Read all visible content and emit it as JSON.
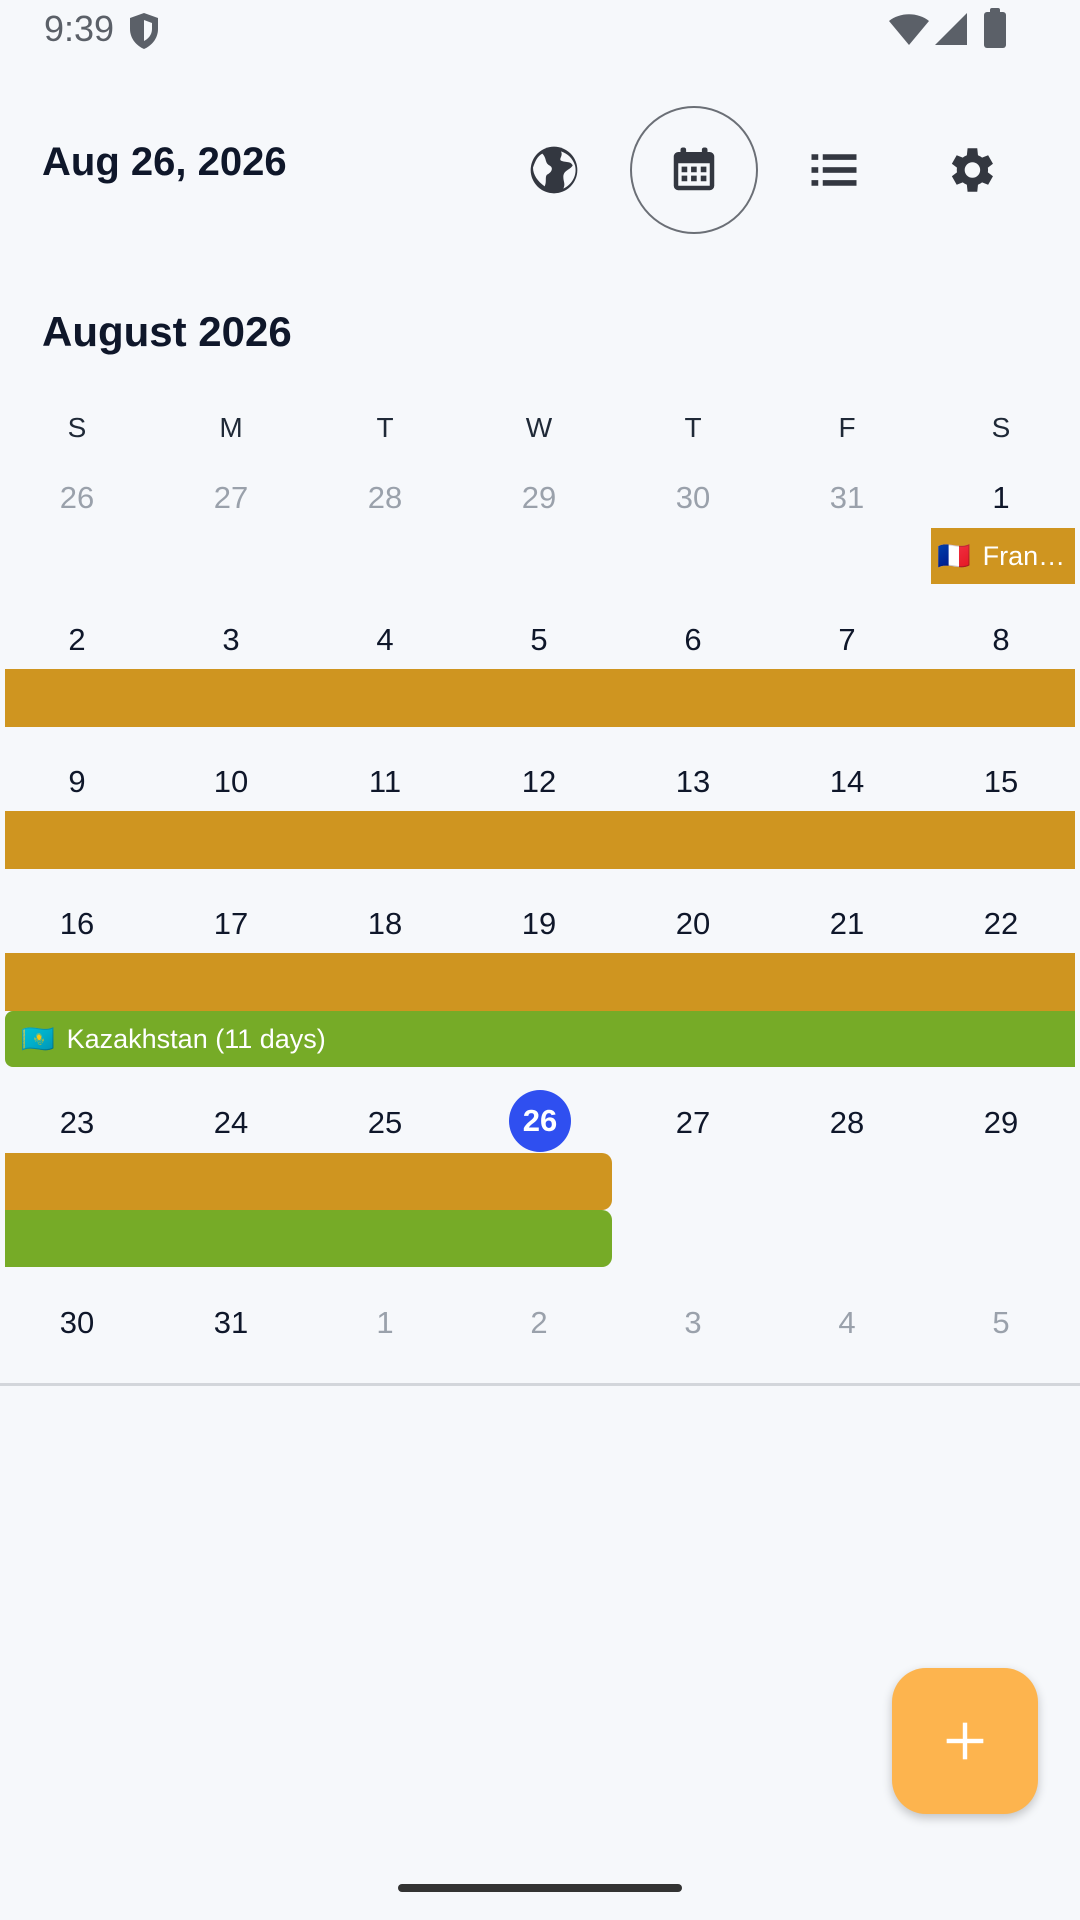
{
  "status": {
    "time": "9:39"
  },
  "header": {
    "date": "Aug 26, 2026"
  },
  "toolbar": {
    "icons": [
      "globe-icon",
      "calendar-icon",
      "list-icon",
      "gear-icon"
    ],
    "selected": "calendar"
  },
  "calendar": {
    "month_title": "August 2026",
    "weekdays": [
      "S",
      "M",
      "T",
      "W",
      "T",
      "F",
      "S"
    ],
    "weeks": [
      [
        "26",
        "27",
        "28",
        "29",
        "30",
        "31",
        "1"
      ],
      [
        "2",
        "3",
        "4",
        "5",
        "6",
        "7",
        "8"
      ],
      [
        "9",
        "10",
        "11",
        "12",
        "13",
        "14",
        "15"
      ],
      [
        "16",
        "17",
        "18",
        "19",
        "20",
        "21",
        "22"
      ],
      [
        "23",
        "24",
        "25",
        "26",
        "27",
        "28",
        "29"
      ],
      [
        "30",
        "31",
        "1",
        "2",
        "3",
        "4",
        "5"
      ]
    ],
    "today": "26",
    "events": {
      "france": {
        "label": "Fran…",
        "flag": "🇫🇷",
        "color": "#cf9520"
      },
      "kazakhstan": {
        "label": "Kazakhstan (11 days)",
        "flag": "🇰🇿",
        "color": "#76ab27"
      }
    }
  },
  "fab": {
    "icon": "plus-icon",
    "color": "#fdb44e"
  }
}
